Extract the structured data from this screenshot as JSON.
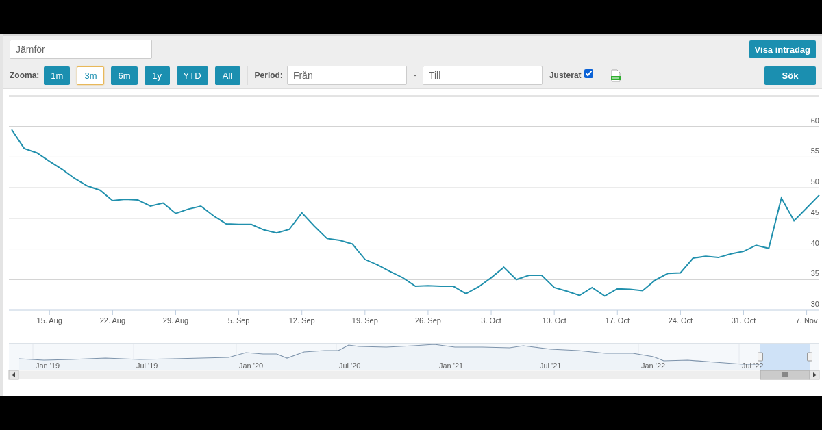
{
  "toolbar": {
    "compare_field": {
      "placeholder": "Jämför"
    },
    "intraday_button": "Visa intradag",
    "zoom_label": "Zooma:",
    "zoom_buttons": [
      {
        "label": "1m",
        "selected": false
      },
      {
        "label": "3m",
        "selected": true
      },
      {
        "label": "6m",
        "selected": false
      },
      {
        "label": "1y",
        "selected": false
      },
      {
        "label": "YTD",
        "selected": false
      },
      {
        "label": "All",
        "selected": false
      }
    ],
    "period_label": "Period:",
    "from_field": {
      "placeholder": "Från"
    },
    "separator": "-",
    "to_field": {
      "placeholder": "Till"
    },
    "adjusted": {
      "label": "Justerat",
      "checked": true
    },
    "search_button": "Sök"
  },
  "chart": {
    "chart_data": {
      "type": "line",
      "categories": [
        null,
        null,
        null,
        "15. Aug",
        null,
        null,
        null,
        null,
        "22. Aug",
        null,
        null,
        null,
        null,
        "29. Aug",
        null,
        null,
        null,
        null,
        "5. Sep",
        null,
        null,
        null,
        null,
        "12. Sep",
        null,
        null,
        null,
        null,
        "19. Sep",
        null,
        null,
        null,
        null,
        "26. Sep",
        null,
        null,
        null,
        null,
        "3. Oct",
        null,
        null,
        null,
        null,
        "10. Oct",
        null,
        null,
        null,
        null,
        "17. Oct",
        null,
        null,
        null,
        null,
        "24. Oct",
        null,
        null,
        null,
        null,
        "31. Oct",
        null,
        null,
        null,
        null,
        "7. Nov",
        null
      ],
      "series": [
        {
          "color": "#2190ad",
          "values": [
            59.5,
            56.4,
            55.7,
            54.3,
            53.0,
            51.5,
            50.3,
            49.6,
            47.9,
            48.1,
            48.0,
            47.0,
            47.5,
            45.8,
            46.5,
            47.0,
            45.4,
            44.1,
            44.0,
            44.0,
            43.1,
            42.6,
            43.2,
            45.9,
            43.7,
            41.7,
            41.4,
            40.8,
            38.3,
            37.4,
            36.3,
            35.3,
            33.9,
            34.0,
            33.9,
            33.9,
            32.7,
            33.8,
            35.3,
            37.0,
            35.0,
            35.7,
            35.7,
            33.7,
            33.1,
            32.4,
            33.7,
            32.3,
            33.5,
            33.4,
            33.2,
            34.9,
            36.0,
            36.1,
            38.5,
            38.8,
            38.6,
            39.2,
            39.6,
            40.6,
            40.1,
            48.3,
            44.6,
            46.7,
            48.8
          ]
        }
      ],
      "ylim": [
        30,
        65
      ],
      "yticks": [
        30,
        35,
        40,
        45,
        50,
        55,
        60
      ],
      "grid": true
    }
  },
  "navigator": {
    "labels": [
      "Jan '19",
      "Jul '19",
      "Jan '20",
      "Jul '20",
      "Jan '21",
      "Jul '21",
      "Jan '22",
      "Jul '22"
    ]
  }
}
